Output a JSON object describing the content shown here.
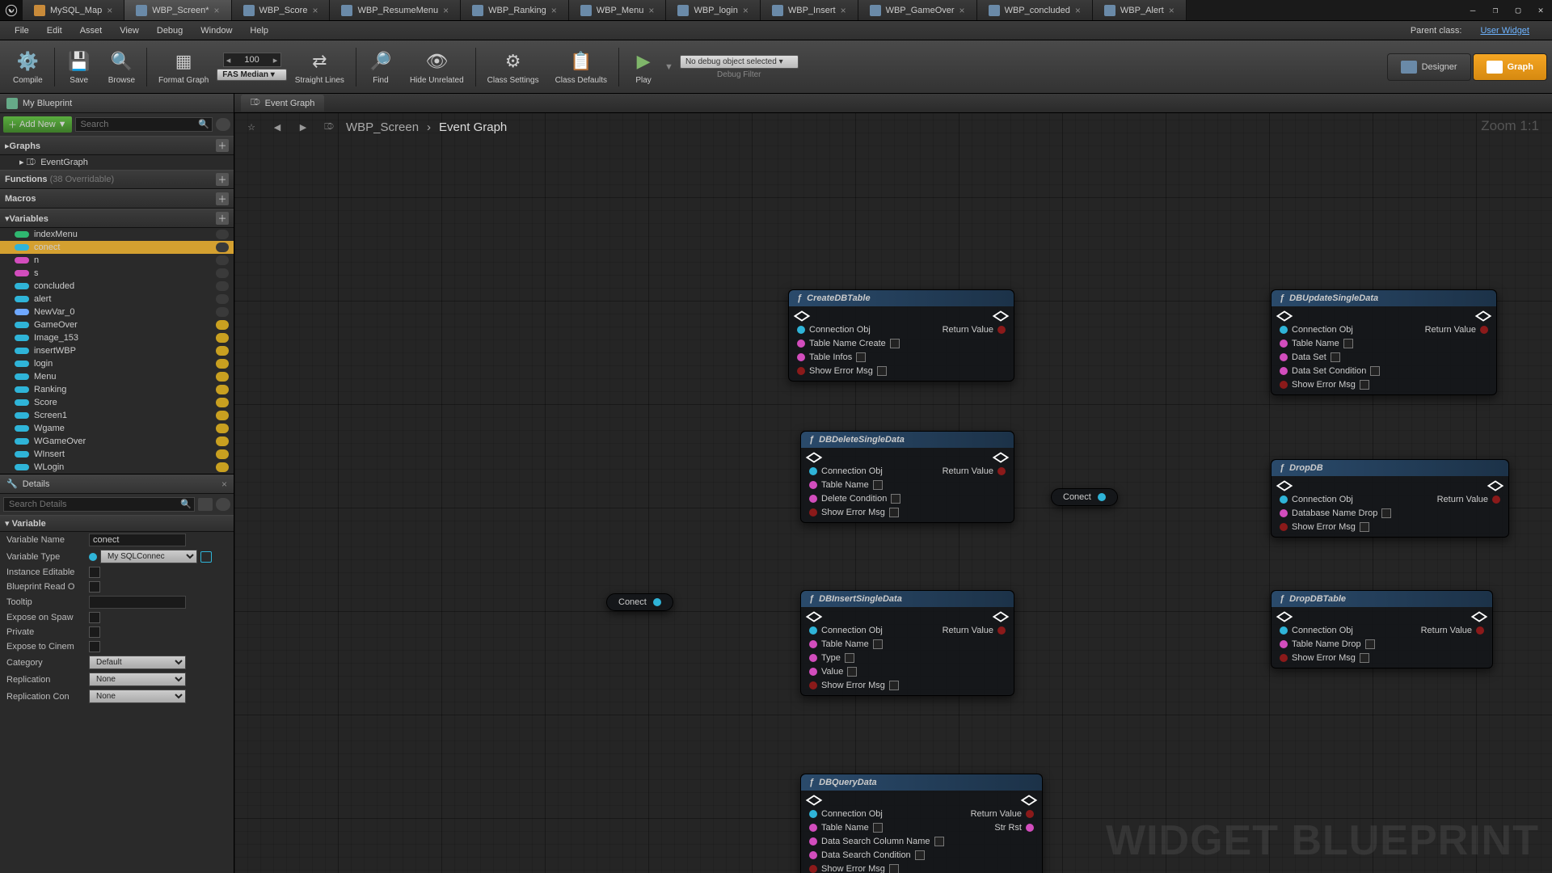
{
  "tabs": {
    "list": [
      {
        "label": "MySQL_Map",
        "map": true
      },
      {
        "label": "WBP_Screen*",
        "active": true
      },
      {
        "label": "WBP_Score"
      },
      {
        "label": "WBP_ResumeMenu"
      },
      {
        "label": "WBP_Ranking"
      },
      {
        "label": "WBP_Menu"
      },
      {
        "label": "WBP_login"
      },
      {
        "label": "WBP_Insert"
      },
      {
        "label": "WBP_GameOver"
      },
      {
        "label": "WBP_concluded"
      },
      {
        "label": "WBP_Alert"
      }
    ]
  },
  "menubar": [
    "File",
    "Edit",
    "Asset",
    "View",
    "Debug",
    "Window",
    "Help"
  ],
  "parent_class": {
    "label": "Parent class:",
    "value": "User Widget"
  },
  "toolbar": {
    "compile": "Compile",
    "save": "Save",
    "browse": "Browse",
    "format": "Format Graph",
    "num": "100",
    "fas": "FAS Median ▾",
    "straight": "Straight Lines",
    "find": "Find",
    "hide": "Hide Unrelated",
    "class_settings": "Class Settings",
    "class_defaults": "Class Defaults",
    "play": "Play",
    "debug_sel": "No debug object selected ▾",
    "debug_filter": "Debug Filter",
    "designer": "Designer",
    "graph": "Graph"
  },
  "blueprint_panel": {
    "title": "My Blueprint",
    "addnew": "Add New",
    "search_ph": "Search",
    "sections": {
      "graphs": "Graphs",
      "functions": "Functions",
      "fn_hint": "(38 Overridable)",
      "macros": "Macros",
      "variables": "Variables"
    },
    "eventgraph": "EventGraph",
    "vars": [
      {
        "name": "indexMenu",
        "color": "#2fb770",
        "eye": false
      },
      {
        "name": "conect",
        "color": "#2fb4d8",
        "eye": false,
        "sel": true
      },
      {
        "name": "n",
        "color": "#d24dbd",
        "eye": false
      },
      {
        "name": "s",
        "color": "#d24dbd",
        "eye": false
      },
      {
        "name": "concluded",
        "color": "#2fb4d8",
        "eye": false
      },
      {
        "name": "alert",
        "color": "#2fb4d8",
        "eye": false
      },
      {
        "name": "NewVar_0",
        "color": "#6fa8ff",
        "eye": false
      },
      {
        "name": "GameOver",
        "color": "#2fb4d8",
        "eye": true
      },
      {
        "name": "Image_153",
        "color": "#2fb4d8",
        "eye": true
      },
      {
        "name": "insertWBP",
        "color": "#2fb4d8",
        "eye": true
      },
      {
        "name": "login",
        "color": "#2fb4d8",
        "eye": true
      },
      {
        "name": "Menu",
        "color": "#2fb4d8",
        "eye": true
      },
      {
        "name": "Ranking",
        "color": "#2fb4d8",
        "eye": true
      },
      {
        "name": "Score",
        "color": "#2fb4d8",
        "eye": true
      },
      {
        "name": "Screen1",
        "color": "#2fb4d8",
        "eye": true
      },
      {
        "name": "Wgame",
        "color": "#2fb4d8",
        "eye": true
      },
      {
        "name": "WGameOver",
        "color": "#2fb4d8",
        "eye": true
      },
      {
        "name": "WInsert",
        "color": "#2fb4d8",
        "eye": true
      },
      {
        "name": "WLogin",
        "color": "#2fb4d8",
        "eye": true
      }
    ]
  },
  "details": {
    "title": "Details",
    "search_ph": "Search Details",
    "section": "Variable",
    "rows": {
      "varname": {
        "l": "Variable Name",
        "v": "conect"
      },
      "vartype": {
        "l": "Variable Type",
        "v": "My SQLConnec"
      },
      "inst": {
        "l": "Instance Editable"
      },
      "bpro": {
        "l": "Blueprint Read O"
      },
      "tooltip": {
        "l": "Tooltip",
        "v": ""
      },
      "spawn": {
        "l": "Expose on Spaw"
      },
      "private": {
        "l": "Private"
      },
      "cinem": {
        "l": "Expose to Cinem"
      },
      "category": {
        "l": "Category",
        "v": "Default"
      },
      "repl": {
        "l": "Replication",
        "v": "None"
      },
      "replcon": {
        "l": "Replication Con",
        "v": "None"
      }
    }
  },
  "graph": {
    "tab": "Event Graph",
    "bc1": "WBP_Screen",
    "bc2": "Event Graph",
    "zoom": "Zoom 1:1",
    "watermark": "WIDGET BLUEPRINT",
    "conect": "Conect",
    "nodes": {
      "createdb": {
        "title": "CreateDBTable",
        "pins": [
          "Connection Obj",
          "Table Name Create",
          "Table Infos",
          "Show Error Msg"
        ],
        "out": "Return Value"
      },
      "deletesingle": {
        "title": "DBDeleteSingleData",
        "pins": [
          "Connection Obj",
          "Table Name",
          "Delete Condition",
          "Show Error Msg"
        ],
        "out": "Return Value"
      },
      "insertsingle": {
        "title": "DBInsertSingleData",
        "pins": [
          "Connection Obj",
          "Table Name",
          "Type",
          "Value",
          "Show Error Msg"
        ],
        "out": "Return Value"
      },
      "query": {
        "title": "DBQueryData",
        "pins": [
          "Connection Obj",
          "Table Name",
          "Data Search Column Name",
          "Data Search Condition",
          "Show Error Msg"
        ],
        "out": "Return Value",
        "out2": "Str Rst"
      },
      "updatesingle": {
        "title": "DBUpdateSingleData",
        "pins": [
          "Connection Obj",
          "Table Name",
          "Data Set",
          "Data Set Condition",
          "Show Error Msg"
        ],
        "out": "Return Value"
      },
      "dropdb": {
        "title": "DropDB",
        "pins": [
          "Connection Obj",
          "Database Name Drop",
          "Show Error Msg"
        ],
        "out": "Return Value"
      },
      "droptable": {
        "title": "DropDBTable",
        "pins": [
          "Connection Obj",
          "Table Name Drop",
          "Show Error Msg"
        ],
        "out": "Return Value"
      }
    }
  }
}
